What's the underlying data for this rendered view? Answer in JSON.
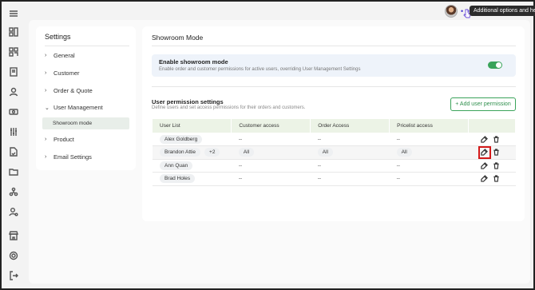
{
  "app": {
    "tooltip": "Additional options and help",
    "menu_dots": "• • •"
  },
  "rail": {
    "icons": [
      "menu-icon",
      "dashboard-icon",
      "qr-icon",
      "document-icon",
      "user-icon",
      "tag-icon",
      "filters-icon",
      "file-check-icon",
      "folder-icon",
      "network-icon",
      "user-cog-icon",
      "store-icon",
      "settings-icon",
      "logout-icon"
    ]
  },
  "settings": {
    "title": "Settings",
    "nav": [
      {
        "label": "General",
        "chevron": "›"
      },
      {
        "label": "Customer",
        "chevron": "›"
      },
      {
        "label": "Order & Quote",
        "chevron": "›"
      },
      {
        "label": "User Management",
        "chevron": "⌄"
      },
      {
        "label": "Product",
        "chevron": "›"
      },
      {
        "label": "Email Settings",
        "chevron": "›"
      }
    ],
    "sub_active": "Showroom mode"
  },
  "page": {
    "title": "Showroom Mode",
    "banner_title": "Enable showroom mode",
    "banner_desc": "Enable order and customer permissions for active users, overriding User Management Settings",
    "toggle_on": true,
    "section_title": "User permission settings",
    "section_desc": "Define users and set access permissions for their orders and customers.",
    "add_button": "+ Add user permission"
  },
  "table": {
    "headers": [
      "User List",
      "Customer access",
      "Order Access",
      "Pricelist access"
    ],
    "rows": [
      {
        "user": "Alex Goldberg",
        "extra": "",
        "customer": "--",
        "order": "--",
        "pricelist": "--"
      },
      {
        "user": "Brandon Attie",
        "extra": "+2",
        "customer": "All",
        "order": "All",
        "pricelist": "All"
      },
      {
        "user": "Ann Quan",
        "extra": "",
        "customer": "--",
        "order": "--",
        "pricelist": "--"
      },
      {
        "user": "Brad Holes",
        "extra": "",
        "customer": "--",
        "order": "--",
        "pricelist": "--"
      }
    ]
  },
  "colors": {
    "accent": "#3aa35a",
    "header_bg": "#ecf3e6",
    "highlight": "#d31919"
  }
}
